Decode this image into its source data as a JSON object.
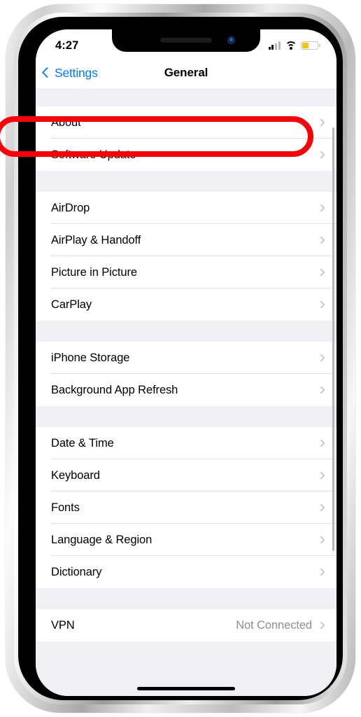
{
  "status_bar": {
    "time": "4:27",
    "cellular_icon": "cellular-signal-icon",
    "wifi_icon": "wifi-icon",
    "battery_icon": "battery-icon",
    "battery_color": "#fcc300",
    "battery_level_percent": 45
  },
  "nav": {
    "back_label": "Settings",
    "back_icon": "chevron-left-icon",
    "title": "General"
  },
  "colors": {
    "accent": "#007aff",
    "annotation": "#fb0007",
    "group_background": "#efeff4",
    "row_background": "#ffffff",
    "separator": "#d6d6da",
    "secondary_text": "#8e8e93"
  },
  "annotation": {
    "shape": "ellipse",
    "target_row": "About",
    "color": "#fb0007"
  },
  "sections": [
    {
      "rows": [
        {
          "label": "About",
          "value": "",
          "chevron": true,
          "highlighted": true
        },
        {
          "label": "Software Update",
          "value": "",
          "chevron": true,
          "highlighted": false
        }
      ]
    },
    {
      "rows": [
        {
          "label": "AirDrop",
          "value": "",
          "chevron": true,
          "highlighted": false
        },
        {
          "label": "AirPlay & Handoff",
          "value": "",
          "chevron": true,
          "highlighted": false
        },
        {
          "label": "Picture in Picture",
          "value": "",
          "chevron": true,
          "highlighted": false
        },
        {
          "label": "CarPlay",
          "value": "",
          "chevron": true,
          "highlighted": false
        }
      ]
    },
    {
      "rows": [
        {
          "label": "iPhone Storage",
          "value": "",
          "chevron": true,
          "highlighted": false
        },
        {
          "label": "Background App Refresh",
          "value": "",
          "chevron": true,
          "highlighted": false
        }
      ]
    },
    {
      "rows": [
        {
          "label": "Date & Time",
          "value": "",
          "chevron": true,
          "highlighted": false
        },
        {
          "label": "Keyboard",
          "value": "",
          "chevron": true,
          "highlighted": false
        },
        {
          "label": "Fonts",
          "value": "",
          "chevron": true,
          "highlighted": false
        },
        {
          "label": "Language & Region",
          "value": "",
          "chevron": true,
          "highlighted": false
        },
        {
          "label": "Dictionary",
          "value": "",
          "chevron": true,
          "highlighted": false
        }
      ]
    },
    {
      "rows": [
        {
          "label": "VPN",
          "value": "Not Connected",
          "chevron": true,
          "highlighted": false
        }
      ]
    }
  ],
  "home_indicator": "home-indicator"
}
